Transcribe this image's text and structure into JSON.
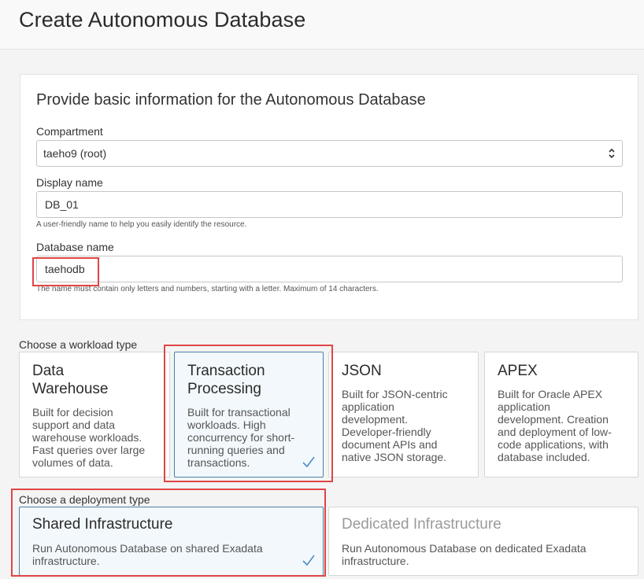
{
  "page": {
    "title": "Create Autonomous Database"
  },
  "basic_info": {
    "title": "Provide basic information for the Autonomous Database",
    "compartment": {
      "label": "Compartment",
      "value": "taeho9 (root)"
    },
    "display_name": {
      "label": "Display name",
      "value": "DB_01",
      "helper": "A user-friendly name to help you easily identify the resource."
    },
    "database_name": {
      "label": "Database name",
      "value": "taehodb",
      "helper": "The name must contain only letters and numbers, starting with a letter. Maximum of 14 characters."
    }
  },
  "workload": {
    "label": "Choose a workload type",
    "options": [
      {
        "title": "Data Warehouse",
        "description": "Built for decision support and data warehouse workloads. Fast queries over large volumes of data.",
        "selected": false
      },
      {
        "title": "Transaction Processing",
        "description": "Built for transactional workloads. High concurrency for short-running queries and transactions.",
        "selected": true
      },
      {
        "title": "JSON",
        "description": "Built for JSON-centric application development. Developer-friendly document APIs and native JSON storage.",
        "selected": false
      },
      {
        "title": "APEX",
        "description": "Built for Oracle APEX application development. Creation and deployment of low-code applications, with database included.",
        "selected": false
      }
    ]
  },
  "deployment": {
    "label": "Choose a deployment type",
    "options": [
      {
        "title": "Shared Infrastructure",
        "description": "Run Autonomous Database on shared Exadata infrastructure.",
        "selected": true
      },
      {
        "title": "Dedicated Infrastructure",
        "description": "Run Autonomous Database on dedicated Exadata infrastructure.",
        "selected": false
      }
    ]
  },
  "colors": {
    "selected_border": "#4a7fa7",
    "selected_bg": "#f3f8fc",
    "check": "#4a8fc7",
    "highlight": "#e04545"
  },
  "icons": {
    "select": "chevron-up-down-icon",
    "selected": "checkmark-icon"
  }
}
